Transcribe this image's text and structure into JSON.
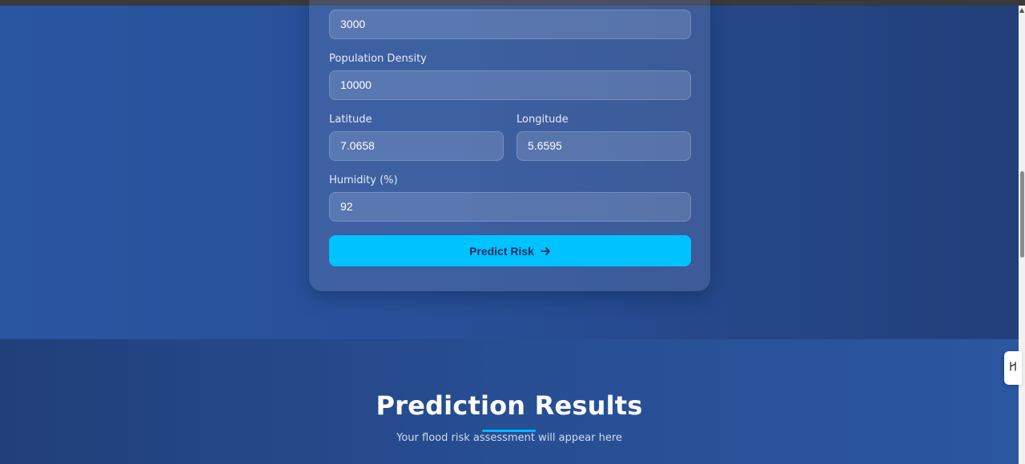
{
  "form": {
    "first_field_value": "3000",
    "population_density": {
      "label": "Population Density",
      "value": "10000"
    },
    "latitude": {
      "label": "Latitude",
      "value": "7.0658"
    },
    "longitude": {
      "label": "Longitude",
      "value": "5.6595"
    },
    "humidity": {
      "label": "Humidity (%)",
      "value": "92"
    },
    "submit_label": "Predict Risk",
    "submit_icon": "arrow-right-icon"
  },
  "results": {
    "title": "Prediction Results",
    "subtitle": "Your flood risk assessment will appear here"
  },
  "side_widget": {
    "icon": "side-tool-icon"
  },
  "colors": {
    "accent": "#00c2ff",
    "background": "#284f97",
    "underline": "#00b7ff"
  }
}
